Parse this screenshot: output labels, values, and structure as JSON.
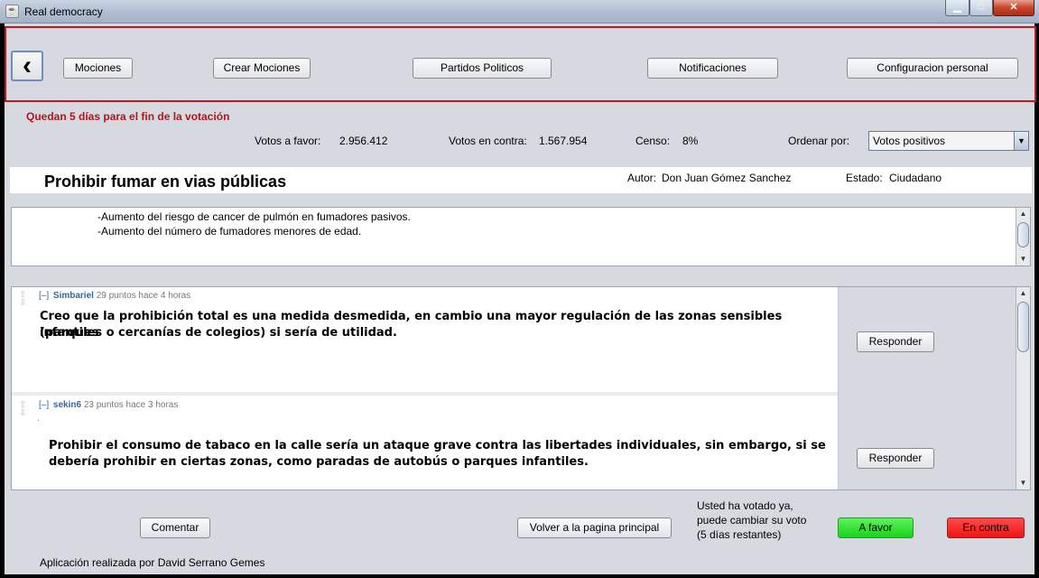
{
  "window": {
    "title": "Real democracy",
    "minimize_glyph": "▁",
    "maximize_glyph": "□",
    "close_glyph": "✕"
  },
  "toolbar": {
    "back_glyph": "‹",
    "buttons": [
      "Mociones",
      "Crear Mociones",
      "Partidos Politicos",
      "Notificaciones",
      "Configuracion personal"
    ]
  },
  "deadline": "Quedan 5 días para el fin de la votación",
  "stats": {
    "favor_label": "Votos a favor:",
    "favor_value": "2.956.412",
    "contra_label": "Votos en contra:",
    "contra_value": "1.567.954",
    "censo_label": "Censo:",
    "censo_value": "8%",
    "order_label": "Ordenar por:",
    "order_value": "Votos positivos"
  },
  "motion": {
    "title": "Prohibir fumar en vias públicas",
    "author_label": "Autor:",
    "author": "Don Juan Gómez Sanchez",
    "state_label": "Estado:",
    "state": "Ciudadano",
    "description": [
      "-Aumento del riesgo de cancer de pulmón en fumadores pasivos.",
      "-Aumento del número de fumadores menores de edad."
    ]
  },
  "comments": [
    {
      "toggle": "[–]",
      "user": "Simbariel",
      "meta": "29 puntos hace 4 horas",
      "body_line1": "Creo que la prohibición total es una medida desmedida, en cambio una mayor regulación de las zonas sensibles (parques",
      "body_line2": "infantiles o cercanías de colegios) si sería de utilidad.",
      "reply_label": "Responder"
    },
    {
      "toggle": "[–]",
      "user": "sekin6",
      "meta": "23 puntos hace 3 horas",
      "dot": ".",
      "body_line1": "Prohibir el consumo de tabaco en la calle sería un ataque grave contra las libertades individuales, sin embargo, si se",
      "body_line2": "debería prohibir en ciertas zonas, como paradas de autobús o parques infantiles.",
      "reply_label": "Responder"
    }
  ],
  "bottom": {
    "comment_label": "Comentar",
    "back_main_label": "Volver a la pagina principal",
    "voted_line1": "Usted ha votado ya,",
    "voted_line2": "puede cambiar su voto",
    "voted_line3": "(5 días restantes)",
    "favor_label": "A favor",
    "contra_label": "En contra",
    "credits": "Aplicación realizada por David Serrano Gemes"
  },
  "colors": {
    "favor": "#19d319",
    "contra": "#ee1414",
    "deadline": "#b2161c",
    "toolbar_border": "#c0191f"
  }
}
